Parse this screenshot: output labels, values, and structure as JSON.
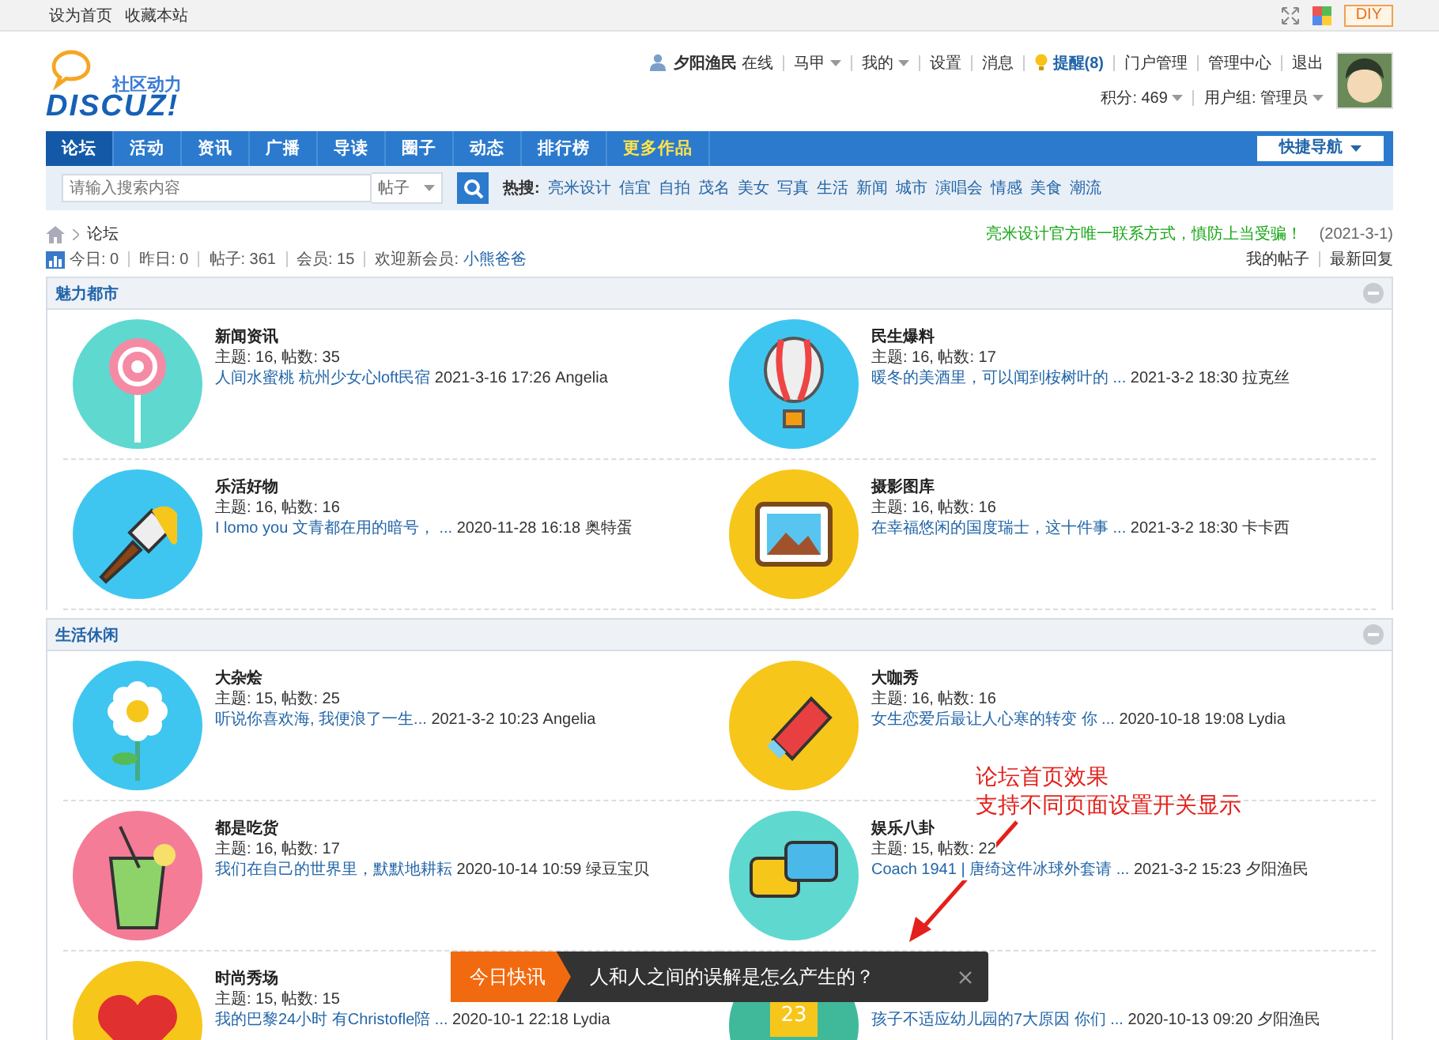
{
  "top_bar": {
    "links": [
      "设为首页",
      "收藏本站"
    ],
    "diy": "DIY"
  },
  "header": {
    "logo_tagline": "社区动力",
    "logo_text": "DISCUZ!",
    "user": "夕阳渔民",
    "status": "在线",
    "menu": [
      {
        "label": "马甲",
        "dropdown": true
      },
      {
        "label": "我的",
        "dropdown": true
      },
      {
        "label": "设置",
        "dropdown": false
      },
      {
        "label": "消息",
        "dropdown": false
      },
      {
        "label": "提醒(8)",
        "dropdown": false,
        "kind": "alert"
      },
      {
        "label": "门户管理",
        "dropdown": false
      },
      {
        "label": "管理中心",
        "dropdown": false
      },
      {
        "label": "退出",
        "dropdown": false
      }
    ],
    "credits": "积分: 469",
    "group": "用户组: 管理员"
  },
  "nav": {
    "items": [
      {
        "label": "论坛",
        "selected": true,
        "kind": "normal"
      },
      {
        "label": "活动",
        "selected": false,
        "kind": "normal"
      },
      {
        "label": "资讯",
        "selected": false,
        "kind": "normal"
      },
      {
        "label": "广播",
        "selected": false,
        "kind": "normal"
      },
      {
        "label": "导读",
        "selected": false,
        "kind": "normal"
      },
      {
        "label": "圈子",
        "selected": false,
        "kind": "normal"
      },
      {
        "label": "动态",
        "selected": false,
        "kind": "normal"
      },
      {
        "label": "排行榜",
        "selected": false,
        "kind": "normal"
      },
      {
        "label": "更多作品",
        "selected": false,
        "kind": "highlight"
      }
    ],
    "quick_nav": "快捷导航"
  },
  "search": {
    "placeholder": "请输入搜索内容",
    "type": "帖子",
    "hot_label": "热搜:",
    "hot": [
      "亮米设计",
      "信宜",
      "自拍",
      "茂名",
      "美女",
      "写真",
      "生活",
      "新闻",
      "城市",
      "演唱会",
      "情感",
      "美食",
      "潮流"
    ]
  },
  "breadcrumb": {
    "current": "论坛",
    "notice": "亮米设计官方唯一联系方式，慎防上当受骗！",
    "date": "(2021-3-1)"
  },
  "stats": {
    "items": [
      "今日: 0",
      "昨日: 0",
      "帖子: 361",
      "会员: 15"
    ],
    "welcome": "欢迎新会员:",
    "new_member": "小熊爸爸",
    "links": [
      "我的帖子",
      "最新回复"
    ]
  },
  "categories": [
    {
      "title": "魅力都市",
      "forums": [
        {
          "name": "新闻资讯",
          "counts": "主题: 16, 帖数: 35",
          "last_title": "人间水蜜桃 杭州少女心loft民宿",
          "last_meta": "2021-3-16 17:26 Angelia"
        },
        {
          "name": "民生爆料",
          "counts": "主题: 16, 帖数: 17",
          "last_title": "暖冬的美酒里，可以闻到桉树叶的 ...",
          "last_meta": "2021-3-2 18:30 拉克丝"
        },
        {
          "name": "乐活好物",
          "counts": "主题: 16, 帖数: 16",
          "last_title": "I lomo you 文青都在用的暗号， ...",
          "last_meta": "2020-11-28 16:18 奥特蛋"
        },
        {
          "name": "摄影图库",
          "counts": "主题: 16, 帖数: 16",
          "last_title": "在幸福悠闲的国度瑞士，这十件事 ...",
          "last_meta": "2021-3-2 18:30 卡卡西"
        }
      ]
    },
    {
      "title": "生活休闲",
      "forums": [
        {
          "name": "大杂烩",
          "counts": "主题: 15, 帖数: 25",
          "last_title": "听说你喜欢海, 我便浪了一生...",
          "last_meta": "2021-3-2 10:23 Angelia"
        },
        {
          "name": "大咖秀",
          "counts": "主题: 16, 帖数: 16",
          "last_title": "女生恋爱后最让人心寒的转变 你 ...",
          "last_meta": "2020-10-18 19:08 Lydia"
        },
        {
          "name": "都是吃货",
          "counts": "主题: 16, 帖数: 17",
          "last_title": "我们在自己的世界里，默默地耕耘",
          "last_meta": "2020-10-14 10:59 绿豆宝贝"
        },
        {
          "name": "娱乐八卦",
          "counts": "主题: 15, 帖数: 22",
          "last_title": "Coach 1941 | 唐绮这件冰球外套请 ...",
          "last_meta": "2021-3-2 15:23 夕阳渔民"
        },
        {
          "name": "时尚秀场",
          "counts": "主题: 15, 帖数: 15",
          "last_title": "我的巴黎24小时 有Christofle陪 ...",
          "last_meta": "2020-10-1 22:18 Lydia"
        },
        {
          "calendar_day": "23",
          "last_title": "孩子不适应幼儿园的7大原因 你们 ...",
          "last_meta": "2020-10-13 09:20 夕阳渔民"
        }
      ]
    }
  ],
  "annotation": {
    "lines": [
      "论坛首页效果",
      "支持不同页面设置开关显示"
    ]
  },
  "news_popup": {
    "label": "今日快讯",
    "text": "人和人之间的误解是怎么产生的？"
  }
}
